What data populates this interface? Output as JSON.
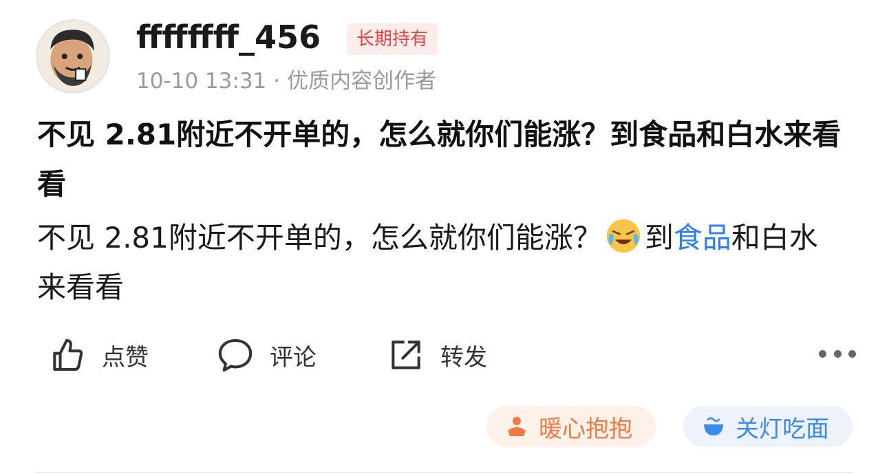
{
  "post": {
    "author": {
      "username": "ffffffff_456",
      "badge": "长期持有",
      "time": "10-10 13:31",
      "separator": "·",
      "role": "优质内容创作者"
    },
    "title": "不见 2.81附近不开单的，怎么就你们能涨？到食品和白水来看看",
    "body": {
      "before_emoji": "不见 2.81附近不开单的，怎么就你们能涨？",
      "emoji": "crying-laughing-emoji",
      "after_emoji": "到",
      "link": "食品",
      "after_link": "和白水来看看"
    }
  },
  "actions": {
    "like": "点赞",
    "comment": "评论",
    "share": "转发"
  },
  "reactions": {
    "hug": "暖心抱抱",
    "noodle": "关灯吃面"
  },
  "colors": {
    "badge_text": "#e4463f",
    "badge_bg": "#fdeceb",
    "link": "#2f80ed",
    "hug": "#f07a44",
    "noodle": "#3a8af0"
  }
}
